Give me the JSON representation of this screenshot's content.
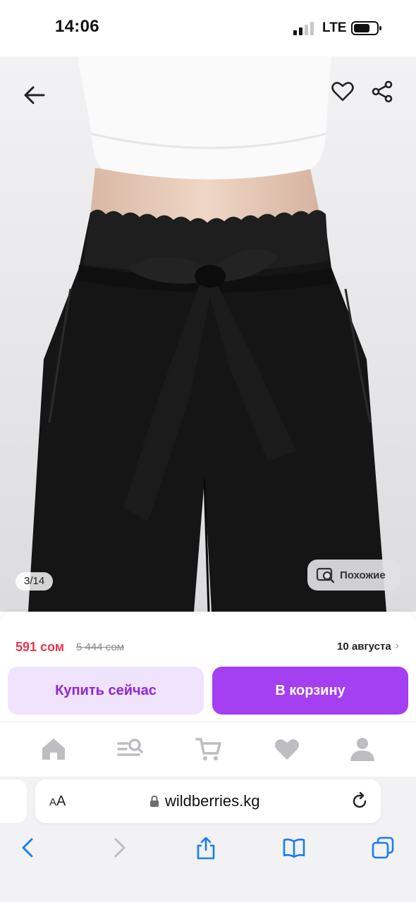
{
  "status_bar": {
    "time": "14:06",
    "network": "LTE"
  },
  "gallery": {
    "counter": "3/14",
    "similar_label": "Похожие",
    "icons": [
      "back-arrow-icon",
      "heart-icon",
      "share-icon",
      "similar-search-icon"
    ]
  },
  "product": {
    "price": "591 сом",
    "old_price": "5 444 сом",
    "delivery_date": "10 августа"
  },
  "actions": {
    "buy_now": "Купить сейчас",
    "add_to_cart": "В корзину"
  },
  "tabbar": {
    "items": [
      "home-icon",
      "catalog-search-icon",
      "cart-icon",
      "favorites-heart-icon",
      "profile-icon"
    ]
  },
  "browser": {
    "text_size_label": "AA",
    "url": "wildberries.kg",
    "toolbar": [
      "back-chevron-icon",
      "forward-chevron-icon",
      "share-icon",
      "bookmarks-book-icon",
      "tabs-icon"
    ]
  },
  "colors": {
    "price_red": "#e5394b",
    "accent_purple": "#a53ff2",
    "buy_button_bg": "#f0e3fd",
    "buy_button_text": "#8e28d8",
    "ios_blue": "#1a7cf5"
  }
}
